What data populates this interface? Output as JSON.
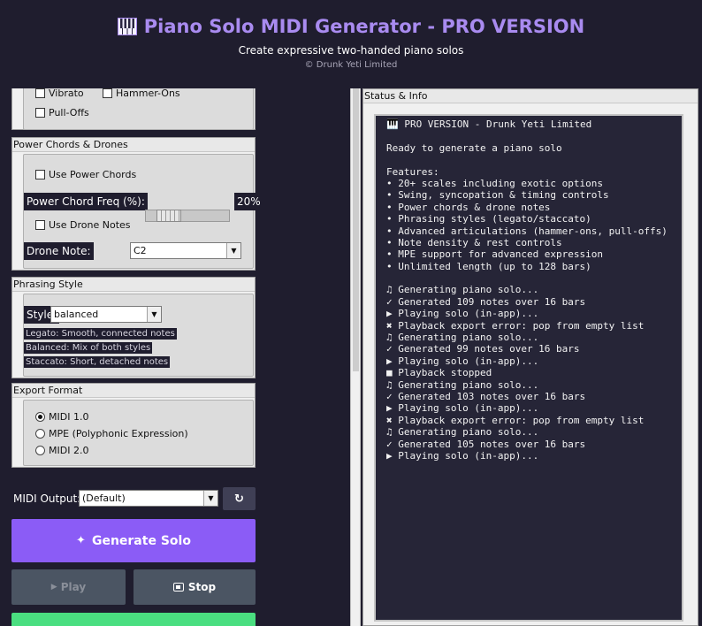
{
  "header": {
    "title": "Piano Solo MIDI Generator - PRO VERSION",
    "subtitle": "Create expressive two-handed piano solos",
    "copyright": "© Drunk Yeti Limited"
  },
  "articulations": {
    "vibrato": "Vibrato",
    "hammer_ons": "Hammer-Ons",
    "pull_offs": "Pull-Offs"
  },
  "power": {
    "title": "Power Chords & Drones",
    "use_power": "Use Power Chords",
    "freq_label": "Power Chord Freq (%):",
    "freq_value": "20%",
    "freq_fraction": 0.2,
    "use_drone": "Use Drone Notes",
    "drone_label": "Drone Note:",
    "drone_value": "C2"
  },
  "phrasing": {
    "title": "Phrasing Style",
    "style_label": "Style:",
    "style_value": "balanced",
    "hint1": "Legato: Smooth, connected notes",
    "hint2": "Balanced: Mix of both styles",
    "hint3": "Staccato: Short, detached notes"
  },
  "export": {
    "title": "Export Format",
    "options": [
      "MIDI 1.0",
      "MPE (Polyphonic Expression)",
      "MIDI 2.0"
    ],
    "selected": "MIDI 1.0"
  },
  "midi": {
    "label": "MIDI Output:",
    "value": "(Default)"
  },
  "buttons": {
    "generate": "Generate Solo",
    "play": "Play",
    "stop": "Stop"
  },
  "status": {
    "title": "Status & Info",
    "lines": [
      "🎹 PRO VERSION - Drunk Yeti Limited",
      "",
      "Ready to generate a piano solo",
      "",
      "Features:",
      "• 20+ scales including exotic options",
      "• Swing, syncopation & timing controls",
      "• Power chords & drone notes",
      "• Phrasing styles (legato/staccato)",
      "• Advanced articulations (hammer-ons, pull-offs)",
      "• Note density & rest controls",
      "• MPE support for advanced expression",
      "• Unlimited length (up to 128 bars)",
      "",
      "♫ Generating piano solo...",
      "✓ Generated 109 notes over 16 bars",
      "▶ Playing solo (in-app)...",
      "✖ Playback export error: pop from empty list",
      "♫ Generating piano solo...",
      "✓ Generated 99 notes over 16 bars",
      "▶ Playing solo (in-app)...",
      "■ Playback stopped",
      "♫ Generating piano solo...",
      "✓ Generated 103 notes over 16 bars",
      "▶ Playing solo (in-app)...",
      "✖ Playback export error: pop from empty list",
      "♫ Generating piano solo...",
      "✓ Generated 105 notes over 16 bars",
      "▶ Playing solo (in-app)..."
    ]
  },
  "colors": {
    "background": "#1f1d2e",
    "accent": "#a98bf0",
    "generate": "#8b5cf6",
    "play_disabled": "#4b5563",
    "stop": "#4b5563",
    "green": "#4ade80"
  }
}
